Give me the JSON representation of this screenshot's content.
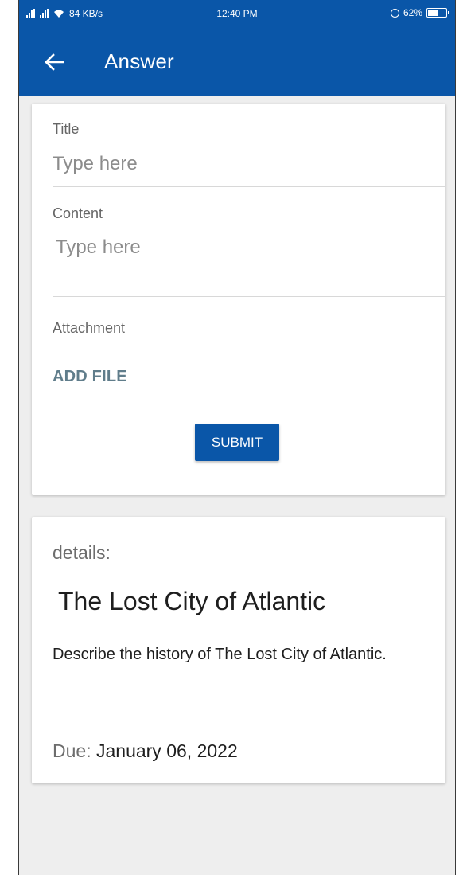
{
  "status_bar": {
    "data_rate": "84 KB/s",
    "time": "12:40 PM",
    "battery": "62%",
    "battery_level": 0.62
  },
  "appbar": {
    "back_icon": "arrow-left-icon",
    "title": "Answer"
  },
  "form": {
    "title_label": "Title",
    "title_placeholder": "Type here",
    "content_label": "Content",
    "content_placeholder": "Type here",
    "attachment_label": "Attachment",
    "add_file_label": "ADD FILE",
    "submit_label": "SUBMIT"
  },
  "details": {
    "heading": "details:",
    "title": "The Lost City of Atlantic",
    "description": "Describe the history of The Lost City of Atlantic.",
    "due_label": "Due:",
    "due_value": "January 06, 2022"
  },
  "colors": {
    "primary": "#0a56a8",
    "background": "#eeeeee",
    "add_file": "#607d8b"
  }
}
